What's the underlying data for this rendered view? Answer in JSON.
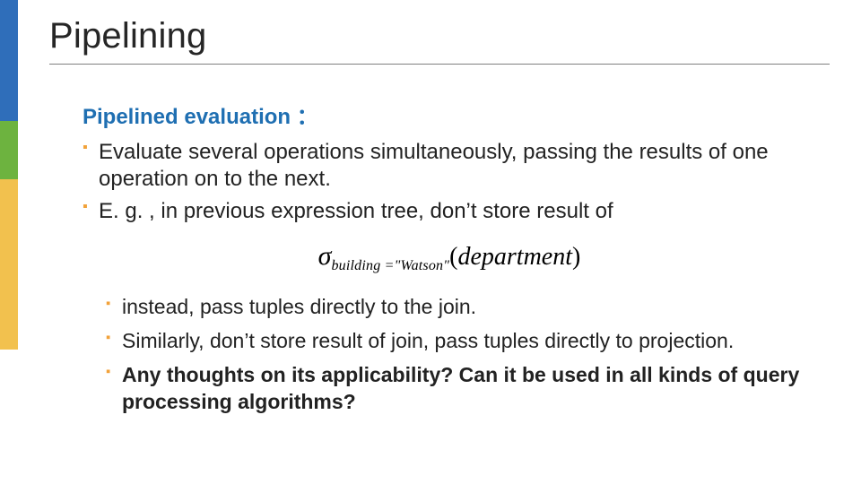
{
  "title": "Pipelining",
  "subhead": "Pipelined evaluation ：",
  "bullets": [
    "Evaluate several operations simultaneously, passing the results of one operation on to the next.",
    "E. g. , in previous expression tree, don’t store result of"
  ],
  "formula": {
    "sigma": "σ",
    "subscript": "building =\"Watson\"",
    "arg_open": "(",
    "arg_text": "department",
    "arg_close": ")"
  },
  "sub_bullets": [
    "instead, pass tuples directly to the join.",
    "Similarly, don’t store result of join, pass tuples directly to projection.",
    "Any thoughts on its applicability? Can it be used in all kinds of query processing algorithms?"
  ]
}
